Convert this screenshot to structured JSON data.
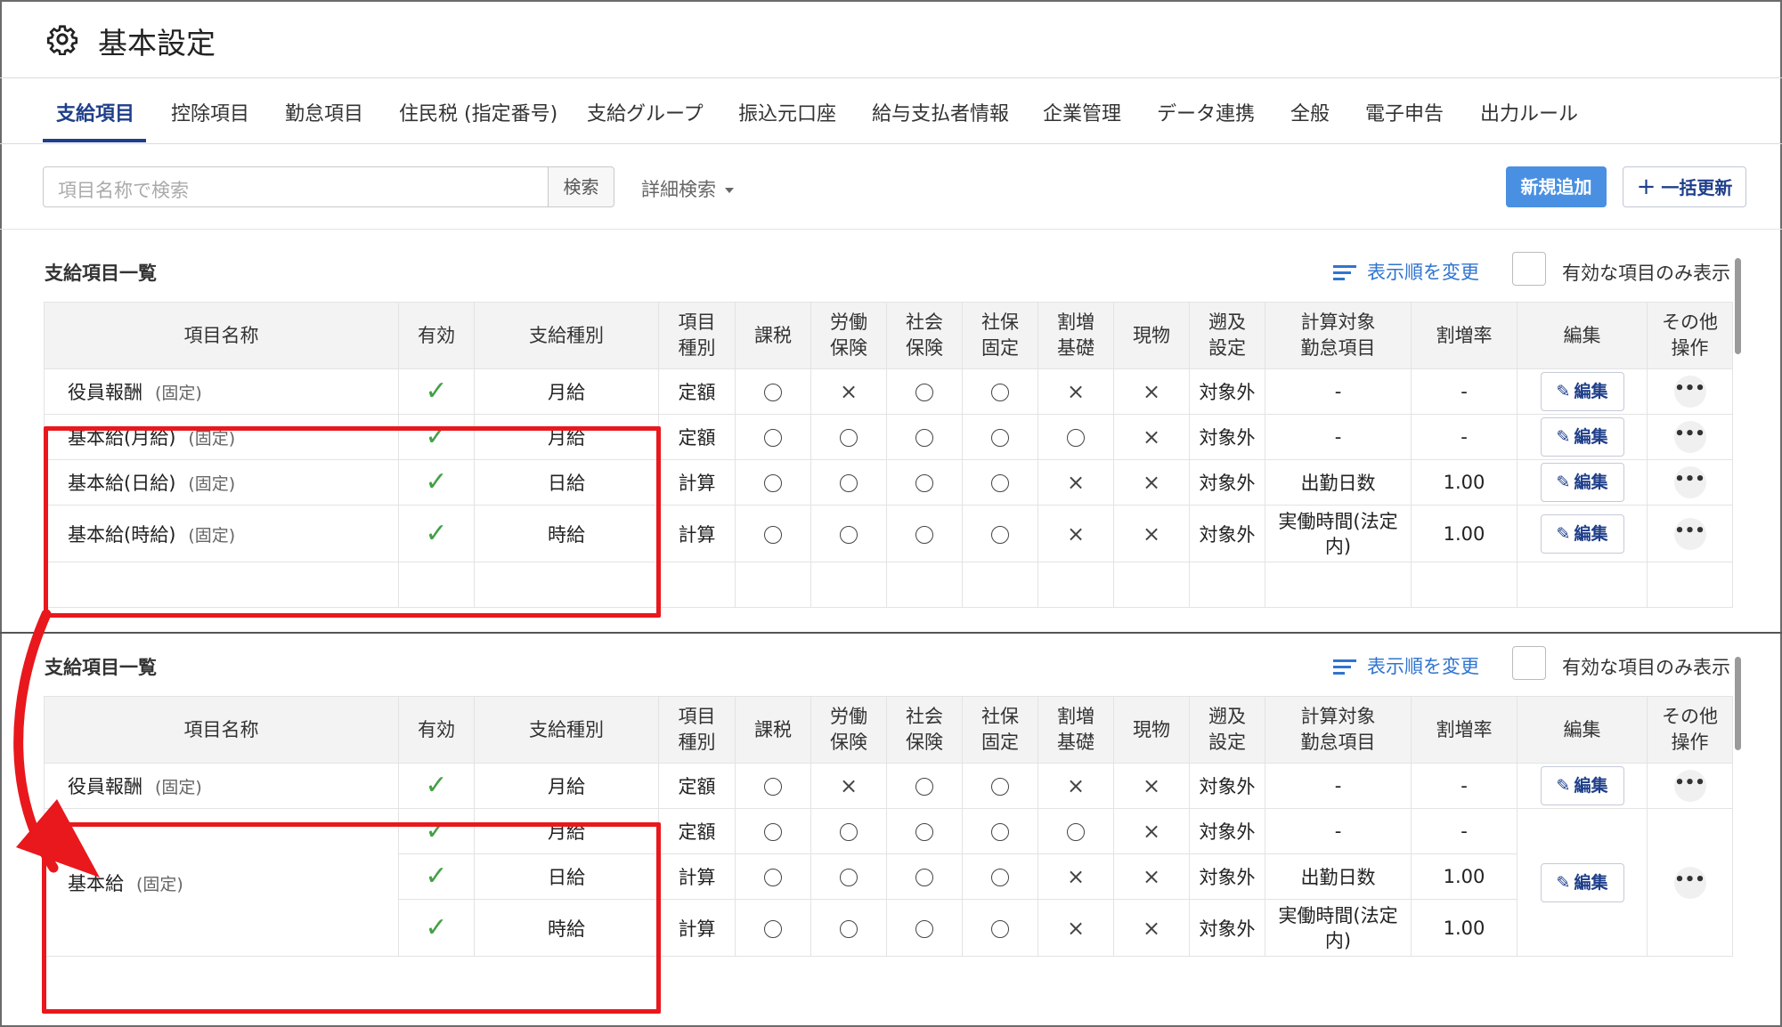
{
  "page": {
    "title": "基本設定"
  },
  "tabs": [
    "支給項目",
    "控除項目",
    "勤怠項目",
    "住民税 (指定番号)",
    "支給グループ",
    "振込元口座",
    "給与支払者情報",
    "企業管理",
    "データ連携",
    "全般",
    "電子申告",
    "出力ルール"
  ],
  "active_tab": "支給項目",
  "toolbar": {
    "search_placeholder": "項目名称で検索",
    "search_button": "検索",
    "advanced_search": "詳細検索",
    "new_button": "新規追加",
    "bulk_update_button": "一括更新"
  },
  "list": {
    "title": "支給項目一覧",
    "reorder": "表示順を変更",
    "only_active": "有効な項目のみ表示"
  },
  "columns": [
    "項目名称",
    "有効",
    "支給種別",
    "項目\n種別",
    "課税",
    "労働\n保険",
    "社会\n保険",
    "社保\n固定",
    "割増\n基礎",
    "現物",
    "遡及\n設定",
    "計算対象\n勤怠項目",
    "割増率",
    "編集",
    "その他\n操作"
  ],
  "labels": {
    "fixed": "(固定)",
    "edit": "編集",
    "more": "•••",
    "check": "✓",
    "maru": "○",
    "batsu": "×"
  },
  "before_rows": [
    {
      "name": "役員報酬",
      "fixed": true,
      "active": true,
      "kind": "月給",
      "item_type": "定額",
      "flags": [
        "○",
        "×",
        "○",
        "○",
        "×",
        "×"
      ],
      "retro": "対象外",
      "target": "-",
      "rate": "-"
    },
    {
      "name": "基本給(月給)",
      "fixed": true,
      "active": true,
      "kind": "月給",
      "item_type": "定額",
      "flags": [
        "○",
        "○",
        "○",
        "○",
        "○",
        "×"
      ],
      "retro": "対象外",
      "target": "-",
      "rate": "-"
    },
    {
      "name": "基本給(日給)",
      "fixed": true,
      "active": true,
      "kind": "日給",
      "item_type": "計算",
      "flags": [
        "○",
        "○",
        "○",
        "○",
        "×",
        "×"
      ],
      "retro": "対象外",
      "target": "出勤日数",
      "rate": "1.00"
    },
    {
      "name": "基本給(時給)",
      "fixed": true,
      "active": true,
      "kind": "時給",
      "item_type": "計算",
      "flags": [
        "○",
        "○",
        "○",
        "○",
        "×",
        "×"
      ],
      "retro": "対象外",
      "target": "実働時間(法定内)",
      "rate": "1.00"
    }
  ],
  "after_rows": {
    "single": {
      "name": "役員報酬",
      "fixed": true,
      "active": true,
      "kind": "月給",
      "item_type": "定額",
      "flags": [
        "○",
        "×",
        "○",
        "○",
        "×",
        "×"
      ],
      "retro": "対象外",
      "target": "-",
      "rate": "-"
    },
    "merged_name": "基本給",
    "merged": [
      {
        "active": true,
        "kind": "月給",
        "item_type": "定額",
        "flags": [
          "○",
          "○",
          "○",
          "○",
          "○",
          "×"
        ],
        "retro": "対象外",
        "target": "-",
        "rate": "-"
      },
      {
        "active": true,
        "kind": "日給",
        "item_type": "計算",
        "flags": [
          "○",
          "○",
          "○",
          "○",
          "×",
          "×"
        ],
        "retro": "対象外",
        "target": "出勤日数",
        "rate": "1.00"
      },
      {
        "active": true,
        "kind": "時給",
        "item_type": "計算",
        "flags": [
          "○",
          "○",
          "○",
          "○",
          "×",
          "×"
        ],
        "retro": "対象外",
        "target": "実働時間(法定内)",
        "rate": "1.00"
      }
    ]
  },
  "colors": {
    "accent": "#1f3f8a",
    "primary_button": "#4a90e2",
    "link": "#2f74d0",
    "check": "#43a047",
    "highlight": "#e8181d"
  }
}
